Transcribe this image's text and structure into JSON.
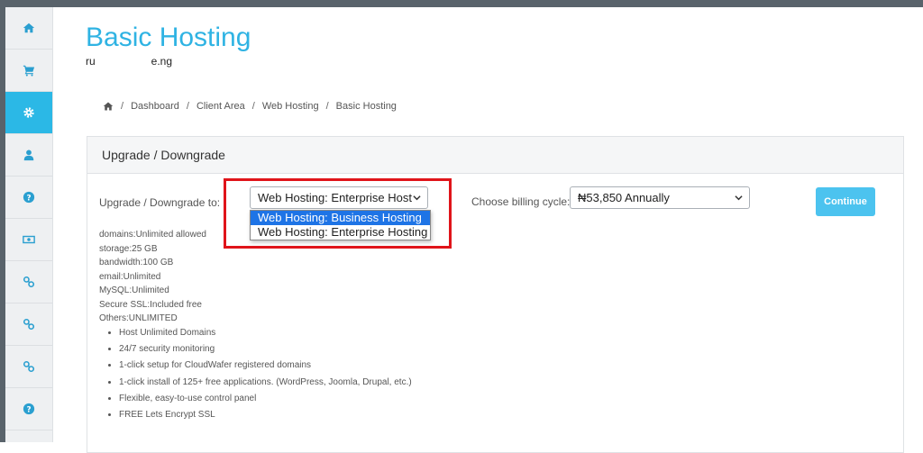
{
  "page": {
    "title": "Basic Hosting",
    "domain_start": "ru",
    "domain_end": "e.ng"
  },
  "sidebar": {
    "items": [
      {
        "icon": "home-icon",
        "active": false
      },
      {
        "icon": "cart-icon",
        "active": false
      },
      {
        "icon": "gear-icon",
        "active": true
      },
      {
        "icon": "user-icon",
        "active": false
      },
      {
        "icon": "help-icon",
        "active": false
      },
      {
        "icon": "money-icon",
        "active": false
      },
      {
        "icon": "link-icon",
        "active": false
      },
      {
        "icon": "link-icon",
        "active": false
      },
      {
        "icon": "link-icon",
        "active": false
      },
      {
        "icon": "help-icon",
        "active": false
      }
    ]
  },
  "breadcrumb": [
    "Dashboard",
    "Client Area",
    "Web Hosting",
    "Basic Hosting"
  ],
  "panel": {
    "heading": "Upgrade / Downgrade",
    "upgrade_label": "Upgrade / Downgrade to:",
    "selected_product": "Web Hosting: Enterprise Host",
    "product_options": [
      "Web Hosting: Business Hosting",
      "Web Hosting: Enterprise Hosting"
    ],
    "billing_label": "Choose billing cycle:",
    "billing_value": "₦53,850 Annually",
    "continue_label": "Continue"
  },
  "specs": [
    "domains:Unlimited allowed",
    "storage:25 GB",
    "bandwidth:100 GB",
    "email:Unlimited",
    "MySQL:Unlimited",
    "Secure SSL:Included free",
    "Others:UNLIMITED"
  ],
  "features": [
    "Host Unlimited Domains",
    "24/7 security monitoring",
    "1-click setup for CloudWafer registered domains",
    "1-click install of 125+ free applications. (WordPress, Joomla, Drupal, etc.)",
    "Flexible, easy-to-use control panel",
    "FREE Lets Encrypt SSL"
  ],
  "colors": {
    "accent": "#2fb3e3",
    "sidebar_active": "#2bb8e6",
    "button": "#4cc3ef",
    "highlight": "#e0141a",
    "dropdown_selected": "#1e74e6"
  }
}
